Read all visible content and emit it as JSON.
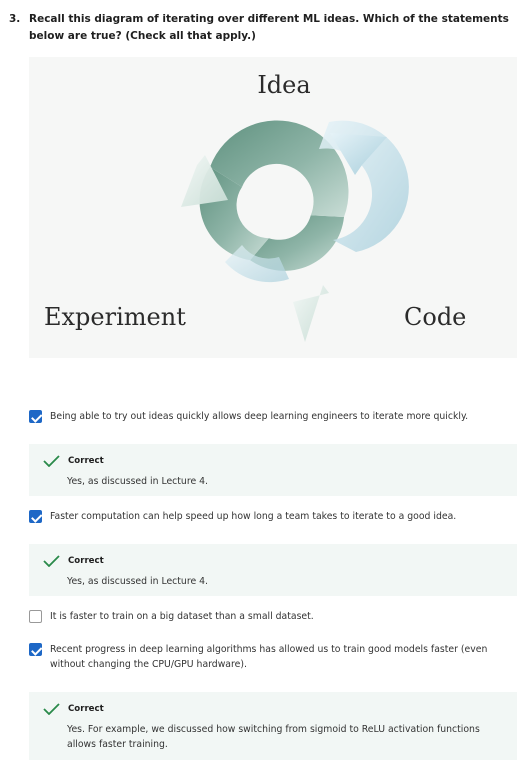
{
  "question": {
    "number": "3.",
    "text": "Recall this diagram of iterating over different ML ideas. Which of the statements below are true? (Check all that apply.)"
  },
  "figure": {
    "label_top": "Idea",
    "label_right": "Code",
    "label_left": "Experiment",
    "colors": {
      "background": "#f6f7f6",
      "ring_dark": "#6f9c8c",
      "ring_light": "#d3e7f0"
    }
  },
  "options": [
    {
      "text": "Being able to try out ideas quickly allows deep learning engineers to iterate more quickly.",
      "checked": true,
      "feedback": {
        "title": "Correct",
        "text": "Yes, as discussed in Lecture 4."
      }
    },
    {
      "text": "Faster computation can help speed up how long a team takes to iterate to a good idea.",
      "checked": true,
      "feedback": {
        "title": "Correct",
        "text": "Yes, as discussed in Lecture 4."
      }
    },
    {
      "text": "It is faster to train on a big dataset than a small dataset.",
      "checked": false
    },
    {
      "text": "Recent progress in deep learning algorithms has allowed us to train good models faster (even without changing the CPU/GPU hardware).",
      "checked": true,
      "feedback": {
        "title": "Correct",
        "text": "Yes. For example, we discussed how switching from sigmoid to ReLU activation functions allows faster training."
      }
    }
  ],
  "colors": {
    "checkbox_checked": "#1d67c6",
    "correct_green": "#2a8a4a",
    "feedback_bg": "#f2f7f5"
  }
}
